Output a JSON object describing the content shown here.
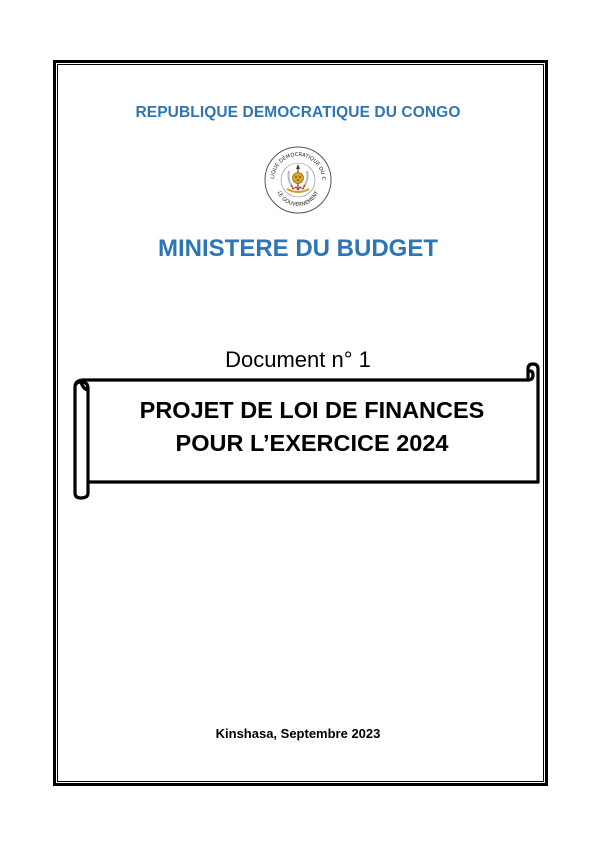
{
  "header": {
    "country": "REPUBLIQUE DEMOCRATIQUE DU CONGO",
    "ministry": "MINISTERE DU BUDGET"
  },
  "seal": {
    "top_text": "RÉPUBLIQUE DÉMOCRATIQUE DU CONGO",
    "bottom_text": "LE GOUVERNEMENT"
  },
  "document": {
    "number": "Document n° 1",
    "title_line1": "PROJET DE LOI DE FINANCES",
    "title_line2": "POUR L’EXERCICE 2024"
  },
  "footer": {
    "place_date": "Kinshasa, Septembre 2023"
  },
  "colors": {
    "accent": "#2e75b6",
    "text": "#000000",
    "border": "#000000"
  }
}
